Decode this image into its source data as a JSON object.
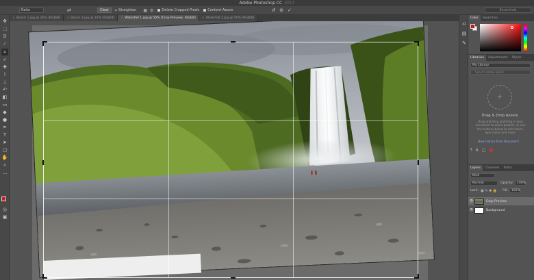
{
  "app": {
    "title": "Adobe Photoshop CC",
    "title_extra": "2017"
  },
  "options": {
    "ratio": "Ratio",
    "clear": "Clear",
    "straighten": "Straighten",
    "delete_cropped": "Delete Cropped Pixels",
    "content_aware": "Content-Aware",
    "workspace": "Essentials"
  },
  "tabs": [
    {
      "label": "Beach 1.jpg @ 25% (RGB/8)"
    },
    {
      "label": "Beach 2.jpg @ 25% (RGB/8)"
    },
    {
      "label": "Waterfall 1.jpg @ 50% (Crop Preview, RGB/8)"
    },
    {
      "label": "Waterfall 2.jpg @ 50% (RGB/8)"
    }
  ],
  "panels": {
    "color_tabs": [
      "Color",
      "Swatches"
    ],
    "library_tabs": [
      "Libraries",
      "Adjustments",
      "Styles"
    ],
    "library_select": "My Library",
    "library_search": "Search Adobe Stock",
    "drag_heading": "Drag & Drop Assets",
    "drag_text": "Drag and drop anything in your document to add a graphic, or use the buttons below to add colors, type styles and more.",
    "library_link": "New Library from Document...",
    "layers_tabs": [
      "Layers",
      "Channels",
      "Paths"
    ],
    "kind": "Kind",
    "blend_mode": "Normal",
    "opacity_label": "Opacity:",
    "opacity": "100%",
    "lock_label": "Lock:",
    "fill_label": "Fill:",
    "fill": "100%",
    "layers": [
      {
        "name": "Crop Preview"
      },
      {
        "name": "Background"
      }
    ]
  },
  "colors": {
    "foreground": "#c51b1b",
    "background": "#ffffff"
  }
}
